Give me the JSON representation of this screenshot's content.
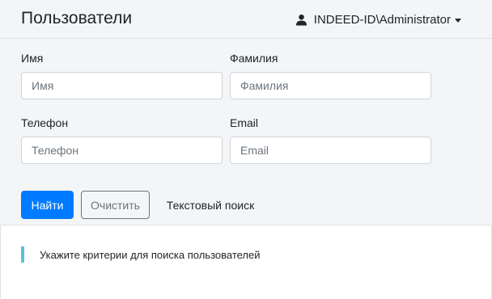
{
  "header": {
    "title": "Пользователи",
    "user": "INDEED-ID\\Administrator",
    "user_icon": "user-icon"
  },
  "form": {
    "first_name": {
      "label": "Имя",
      "placeholder": "Имя",
      "value": ""
    },
    "last_name": {
      "label": "Фамилия",
      "placeholder": "Фамилия",
      "value": ""
    },
    "phone": {
      "label": "Телефон",
      "placeholder": "Телефон",
      "value": ""
    },
    "email": {
      "label": "Email",
      "placeholder": "Email",
      "value": ""
    }
  },
  "actions": {
    "find": "Найти",
    "clear": "Очистить",
    "text_search": "Текстовый поиск"
  },
  "hint": "Укажите критерии для поиска пользователей",
  "colors": {
    "primary": "#007bff",
    "info_border": "#5bc0de",
    "panel_bg": "#f4f5f6"
  }
}
